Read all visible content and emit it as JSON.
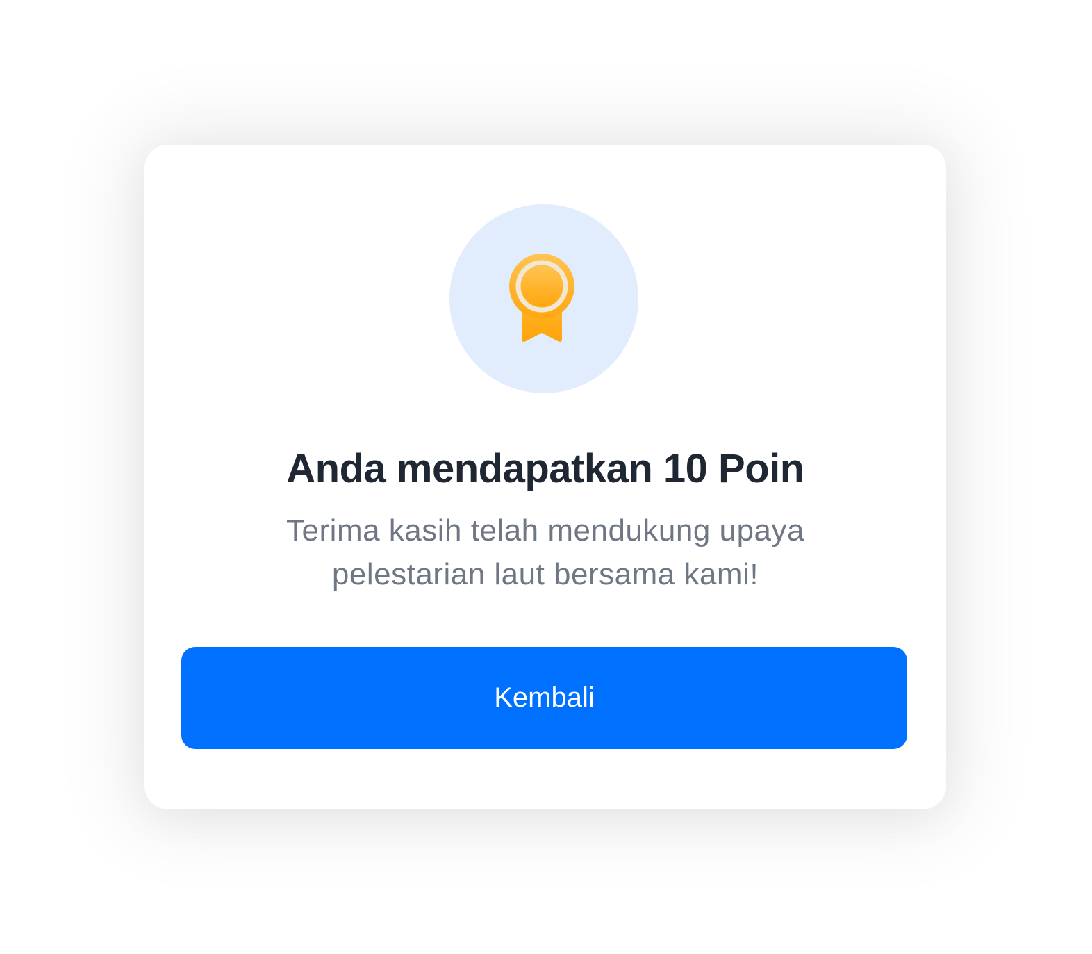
{
  "dialog": {
    "icon": "award-ribbon-icon",
    "title": "Anda mendapatkan 10 Poin",
    "message": "Terima kasih telah mendukung upaya pelestarian laut bersama kami!",
    "button_label": "Kembali"
  },
  "colors": {
    "primary": "#0070ff",
    "icon_background": "#e1edfc",
    "medal_gold": "#ffb51f",
    "title_text": "#1f2733",
    "body_text": "#6f7784"
  }
}
